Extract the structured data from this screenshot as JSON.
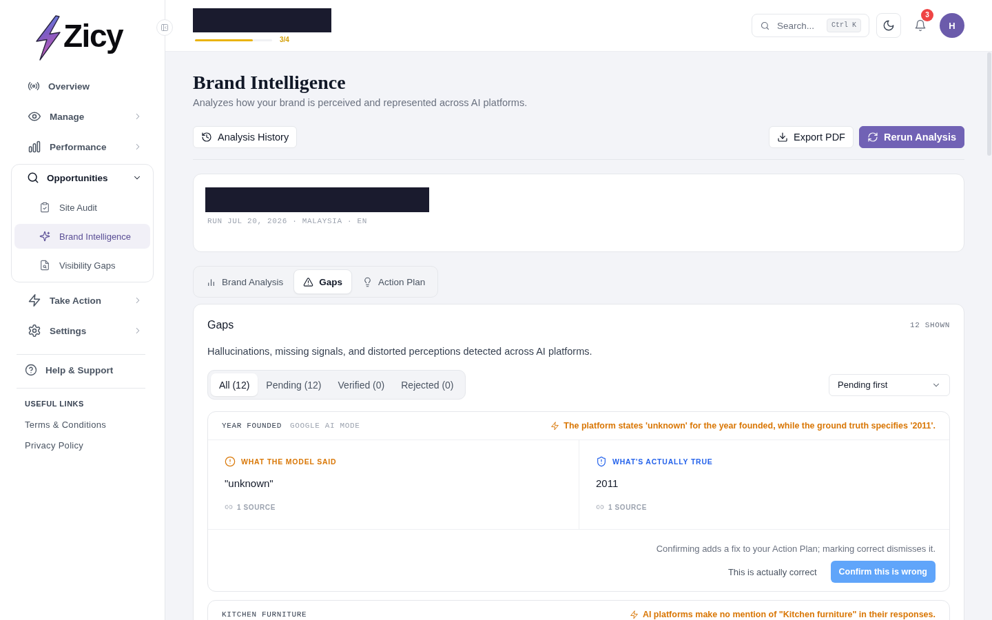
{
  "sidebar": {
    "logo": "Zicy",
    "nav": [
      {
        "label": "Overview",
        "selected": false
      },
      {
        "label": "Manage",
        "selected": false,
        "expanded": false
      },
      {
        "label": "Performance",
        "selected": false,
        "expanded": false
      },
      {
        "label": "Opportunities",
        "selected": false,
        "expanded": true,
        "children": [
          {
            "label": "Site Audit",
            "selected": false
          },
          {
            "label": "Brand Intelligence",
            "selected": true
          },
          {
            "label": "Visibility Gaps",
            "selected": false
          }
        ]
      },
      {
        "label": "Take Action",
        "selected": false,
        "expanded": false
      },
      {
        "label": "Settings",
        "selected": false,
        "expanded": false
      }
    ],
    "support": {
      "label": "Help & Support"
    },
    "useful_links": {
      "heading": "USEFUL LINKS",
      "links": [
        "Terms & Conditions",
        "Privacy Policy"
      ]
    }
  },
  "topbar": {
    "progress": {
      "level": 0.75,
      "label": "3/4"
    },
    "search": {
      "placeholder": "Search...",
      "shortcut": "Ctrl K"
    },
    "notifications": {
      "count": "3"
    },
    "avatar": "H"
  },
  "header": {
    "title": "Brand Intelligence",
    "subtitle": "Analyzes how your brand is perceived and represented across AI platforms.",
    "history_button": "Analysis History",
    "export_button": "Export PDF",
    "rerun_button": "Rerun Analysis"
  },
  "run_card": {
    "meta": "RUN JUL 20, 2026 · MALAYSIA · EN"
  },
  "tabs": [
    {
      "label": "Brand Analysis",
      "selected": false
    },
    {
      "label": "Gaps",
      "selected": true
    },
    {
      "label": "Action Plan",
      "selected": false
    }
  ],
  "gaps": {
    "title": "Gaps",
    "count": "12 SHOWN",
    "description": "Hallucinations, missing signals, and distorted perceptions detected across AI platforms.",
    "filters": [
      {
        "label": "All (12)",
        "selected": true
      },
      {
        "label": "Pending (12)",
        "selected": false
      },
      {
        "label": "Verified (0)",
        "selected": false
      },
      {
        "label": "Rejected (0)",
        "selected": false
      }
    ],
    "sort": {
      "value": "Pending first"
    },
    "items": [
      {
        "attribute": "YEAR FOUNDED",
        "platform": "GOOGLE AI MODE",
        "summary": "The platform states 'unknown' for the year founded, while the ground truth specifies '2011'.",
        "model_said": {
          "label": "WHAT THE MODEL SAID",
          "value": "\"unknown\"",
          "sources": "1 SOURCE"
        },
        "truth": {
          "label": "WHAT'S ACTUALLY TRUE",
          "value": "2011",
          "sources": "1 SOURCE"
        },
        "note": "Confirming adds a fix to your Action Plan; marking correct dismisses it.",
        "actions": {
          "dismiss": "This is actually correct",
          "confirm": "Confirm this is wrong"
        }
      },
      {
        "attribute": "KITCHEN FURNITURE",
        "summary": "AI platforms make no mention of \"Kitchen furniture\" in their responses."
      }
    ]
  }
}
